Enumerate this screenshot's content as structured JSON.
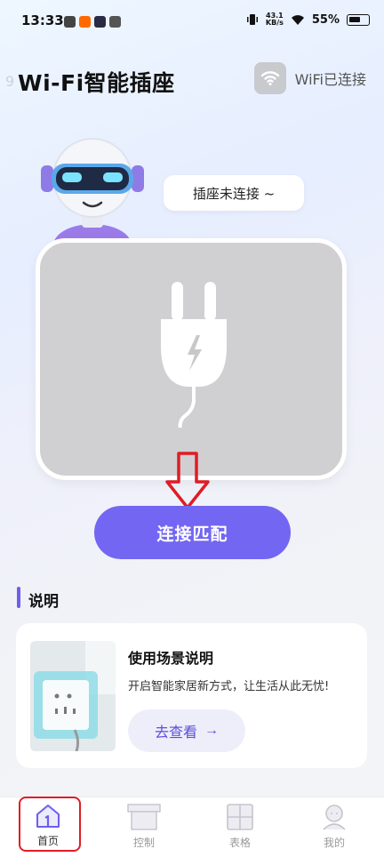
{
  "status_bar": {
    "time": "13:33",
    "net_speed_value": "43.1",
    "net_speed_unit": "KB/s",
    "battery": "55%"
  },
  "header": {
    "title": "Wi-Fi智能插座",
    "bg_temp": "9",
    "wifi_label": "WiFi已连接"
  },
  "device": {
    "bubble_text": "插座未连接 ~",
    "connect_button": "连接匹配"
  },
  "section": {
    "title": "说明"
  },
  "scene_card": {
    "title": "使用场景说明",
    "description": "开启智能家居新方式，让生活从此无忧!",
    "button_label": "去查看",
    "button_arrow": "→"
  },
  "tabs": [
    {
      "label": "首页",
      "icon": "home-icon",
      "active": true
    },
    {
      "label": "控制",
      "icon": "control-icon",
      "active": false
    },
    {
      "label": "表格",
      "icon": "table-icon",
      "active": false
    },
    {
      "label": "我的",
      "icon": "profile-icon",
      "active": false
    }
  ],
  "colors": {
    "accent": "#7366f2",
    "highlight": "#e11c24",
    "card_gray": "#d0d0d2"
  }
}
